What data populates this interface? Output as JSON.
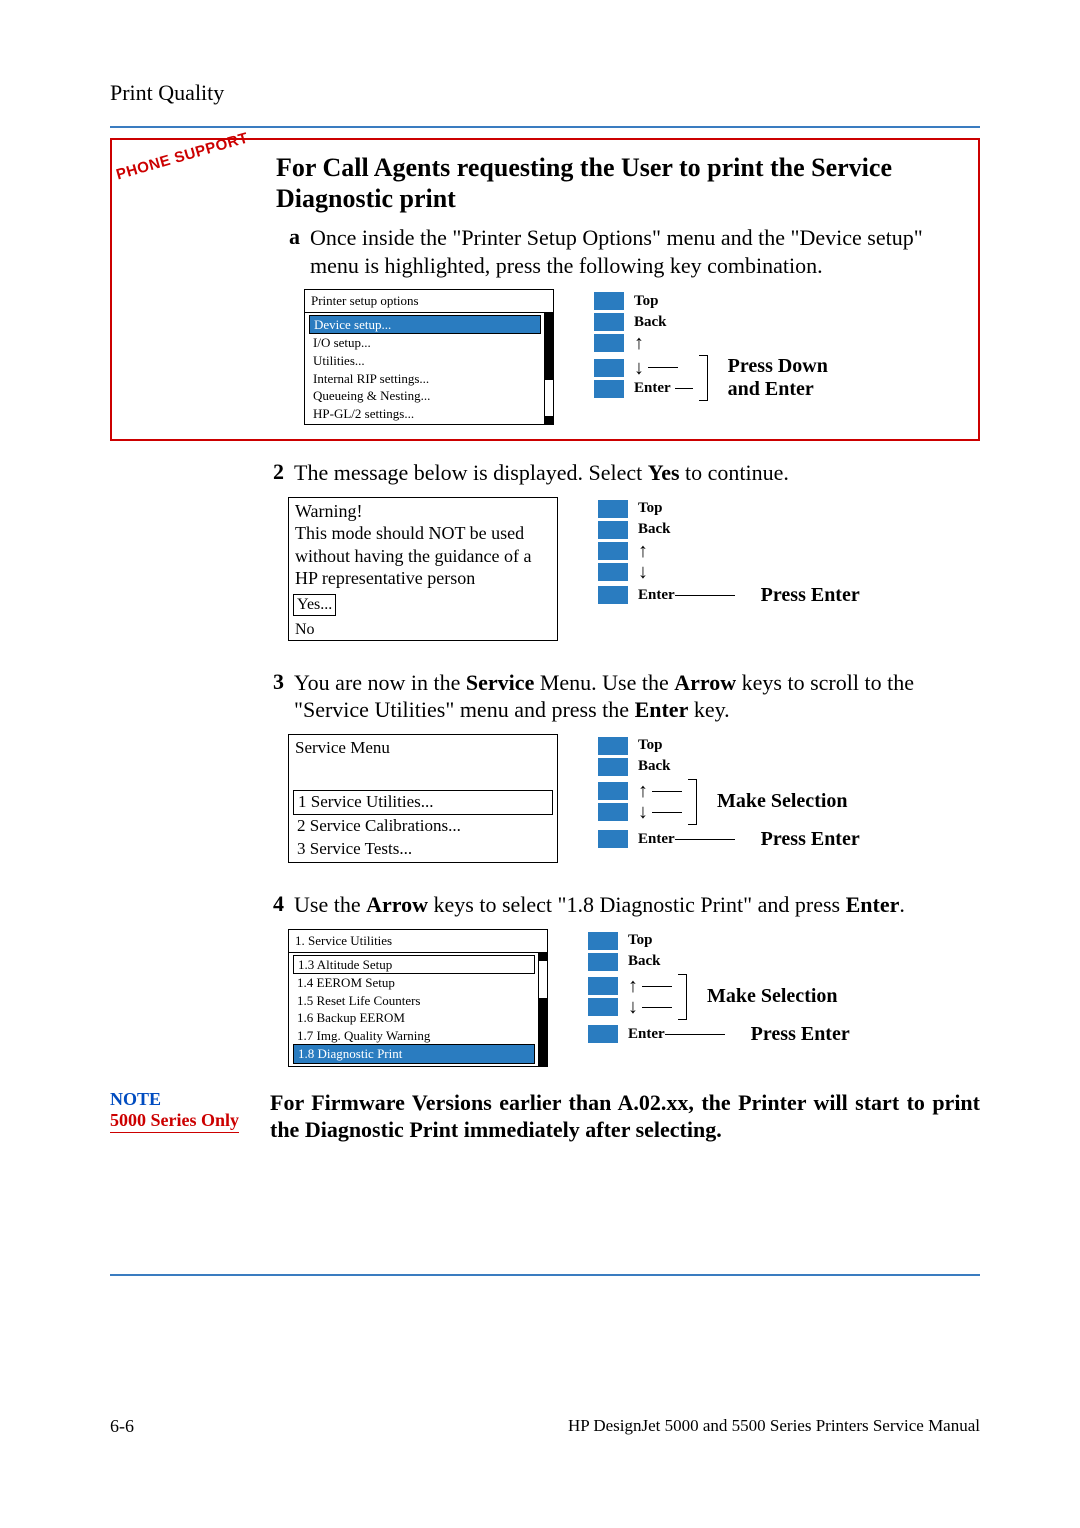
{
  "pageHeader": "Print Quality",
  "phoneStamp": "PHONE SUPPORT",
  "boxed": {
    "title": "For Call Agents requesting the User to print the Service Diagnostic print",
    "step": {
      "num": "a",
      "text": "Once inside the \"Printer Setup Options\" menu and the \"Device setup\" menu is highlighted, press the following key combination."
    },
    "lcdTitle": "Printer setup options",
    "lcdItems": {
      "i0": "Device setup...",
      "i1": "I/O setup...",
      "i2": "Utilities...",
      "i3": "Internal RIP settings...",
      "i4": "Queueing & Nesting...",
      "i5": "HP-GL/2 settings..."
    },
    "callout1": "Press Down",
    "callout2": "and Enter"
  },
  "btns": {
    "top": "Top",
    "back": "Back",
    "up": "↑",
    "down": "↓",
    "enter": "Enter"
  },
  "step2": {
    "num": "2",
    "pre": "The message below is displayed. Select ",
    "bold": "Yes",
    "post": " to continue.",
    "warning": "Warning!\nThis mode should NOT be used without having the guidance of a HP representative person",
    "opt1": "Yes...",
    "opt2": "No",
    "callout": "Press Enter"
  },
  "step3": {
    "num": "3",
    "pre": "You are now in the ",
    "b1": "Service",
    "mid": " Menu. Use the ",
    "b2": "Arrow",
    "mid2": " keys to scroll to the \"Service Utilities\" menu and press the ",
    "b3": "Enter",
    "post": " key.",
    "lcdTitle": "Service Menu",
    "lcdItems": {
      "i0": "1 Service Utilities...",
      "i1": "2 Service Calibrations...",
      "i2": "3 Service Tests..."
    },
    "callout1": "Make Selection",
    "callout2": "Press Enter"
  },
  "step4": {
    "num": "4",
    "pre": "Use the ",
    "b1": "Arrow",
    "mid": " keys to select \"1.8 Diagnostic Print\" and press ",
    "b2": "Enter",
    "post": ".",
    "lcdTitle": "1. Service Utilities",
    "lcdItems": {
      "i0": "1.3 Altitude Setup",
      "i1": "1.4 EEROM Setup",
      "i2": "1.5 Reset Life Counters",
      "i3": "1.6 Backup EEROM",
      "i4": "1.7 Img. Quality Warning",
      "i5": "1.8 Diagnostic Print"
    },
    "callout1": "Make Selection",
    "callout2": "Press Enter"
  },
  "note": {
    "label": "NOTE",
    "series": "5000 Series Only",
    "body": "For Firmware Versions earlier than A.02.xx, the Printer will start to print the Diagnostic Print immediately after selecting."
  },
  "footer": {
    "left": "6-6",
    "right": "HP DesignJet 5000 and 5500 Series Printers Service Manual"
  }
}
